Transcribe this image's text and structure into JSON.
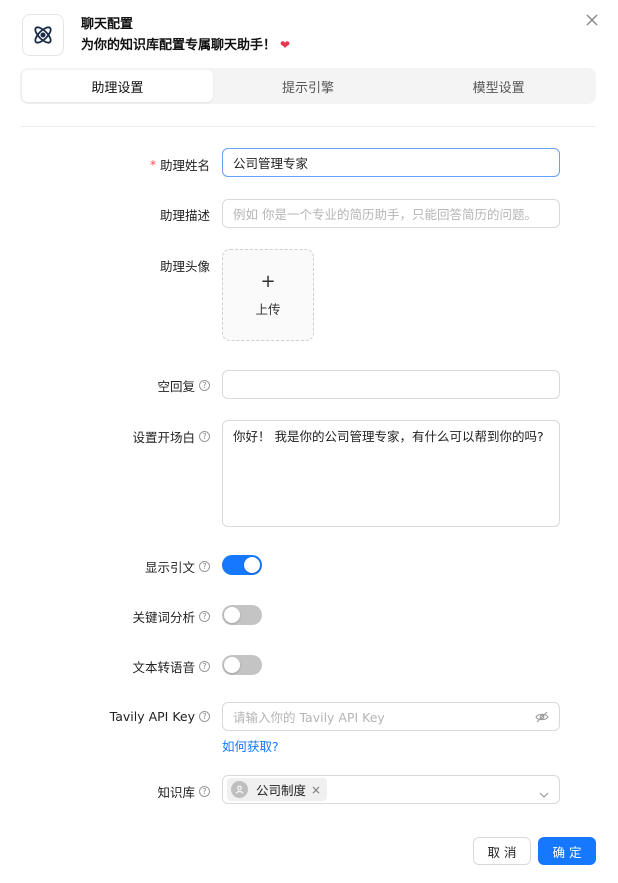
{
  "header": {
    "title": "聊天配置",
    "subtitle": "为你的知识库配置专属聊天助手！",
    "logo_icon": "atom-icon",
    "heart_icon": "heart-icon"
  },
  "tabs": [
    {
      "label": "助理设置",
      "active": true
    },
    {
      "label": "提示引擎",
      "active": false
    },
    {
      "label": "模型设置",
      "active": false
    }
  ],
  "form": {
    "name_label": "助理姓名",
    "name_value": "公司管理专家",
    "desc_label": "助理描述",
    "desc_placeholder": "例如 你是一个专业的简历助手，只能回答简历的问题。",
    "avatar_label": "助理头像",
    "upload_plus": "+",
    "upload_label": "上传",
    "empty_reply_label": "空回复",
    "opener_label": "设置开场白",
    "opener_value": "你好！ 我是你的公司管理专家，有什么可以帮到你的吗?",
    "show_quote_label": "显示引文",
    "show_quote_on": true,
    "keyword_label": "关键词分析",
    "keyword_on": false,
    "tts_label": "文本转语音",
    "tts_on": false,
    "tavily_label": "Tavily API Key",
    "tavily_placeholder": "请输入你的 Tavily API Key",
    "tavily_link": "如何获取?",
    "kb_label": "知识库",
    "kb_tags": [
      "公司制度"
    ]
  },
  "footer": {
    "cancel": "取 消",
    "ok": "确 定"
  },
  "colors": {
    "primary": "#1677ff",
    "required": "#ff4d4f",
    "heart": "#e8344e"
  }
}
